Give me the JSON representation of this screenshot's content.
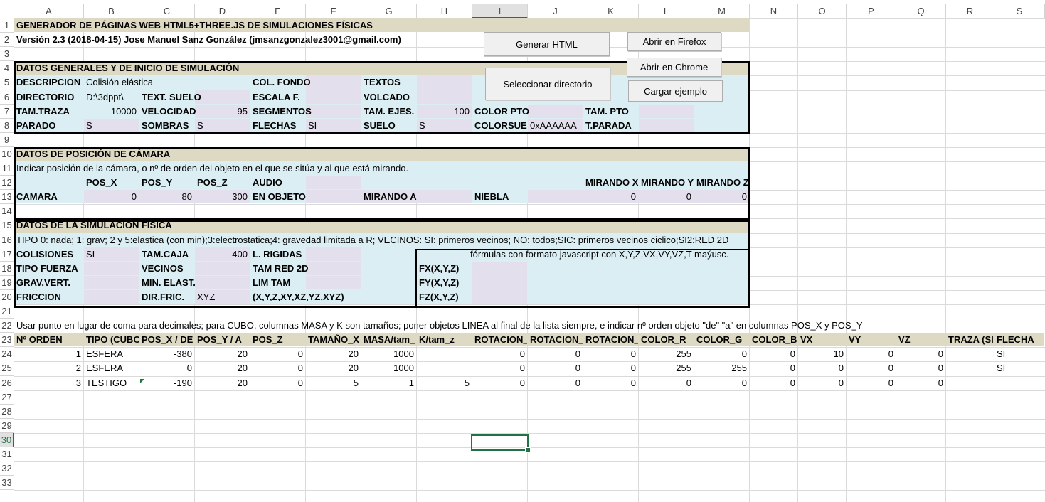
{
  "columns": [
    "A",
    "B",
    "C",
    "D",
    "E",
    "F",
    "G",
    "H",
    "I",
    "J",
    "K",
    "L",
    "M",
    "N",
    "O",
    "P",
    "Q",
    "R",
    "S"
  ],
  "rows": [
    "1",
    "2",
    "3",
    "4",
    "5",
    "6",
    "7",
    "8",
    "9",
    "10",
    "11",
    "12",
    "13",
    "14",
    "15",
    "16",
    "17",
    "18",
    "19",
    "20",
    "21",
    "22",
    "23",
    "24",
    "25",
    "26",
    "27",
    "28",
    "29",
    "30",
    "31",
    "32",
    "33"
  ],
  "selected": {
    "column": "I",
    "row": "30"
  },
  "colors": {
    "header_band": "#ddd9c3",
    "panel": "#daeef3",
    "input": "#e4dfec",
    "accent": "#217346"
  },
  "buttons": {
    "generate": "Generar HTML",
    "firefox": "Abrir en Firefox",
    "select_dir": "Seleccionar directorio",
    "chrome": "Abrir en Chrome",
    "example": "Cargar ejemplo"
  },
  "title": "GENERADOR DE PÁGINAS WEB HTML5+THREE.JS DE SIMULACIONES FÍSICAS",
  "version": "Versión 2.3 (2018-04-15) Jose Manuel Sanz González (jmsanzgonzalez3001@gmail.com)",
  "general": {
    "heading": "DATOS GENERALES Y DE INICIO DE SIMULACIÓN",
    "descripcion_label": "DESCRIPCION",
    "descripcion_value": "Colisión elástica",
    "col_fondo": "COL. FONDO",
    "textos": "TEXTOS",
    "directorio_label": "DIRECTORIO",
    "directorio_value": "D:\\3dppt\\",
    "text_suelo": "TEXT. SUELO",
    "escala": "ESCALA F.",
    "volcado": "VOLCADO",
    "tam_traza_label": "TAM.TRAZA",
    "tam_traza_value": "10000",
    "velocidad_label": "VELOCIDAD",
    "velocidad_value": "95",
    "segmentos": "SEGMENTOS",
    "tam_ejes_label": "TAM. EJES.",
    "tam_ejes_value": "100",
    "color_pto": "COLOR PTO",
    "tam_pto": "TAM. PTO",
    "parado_label": "PARADO",
    "parado_value": "S",
    "sombras_label": "SOMBRAS",
    "sombras_value": "S",
    "flechas_label": "FLECHAS",
    "flechas_value": "SI",
    "suelo_label": "SUELO",
    "suelo_value": "S",
    "colorsuelo_label": "COLORSUELO",
    "colorsuelo_value": "0xAAAAAA",
    "t_parada": "T.PARADA"
  },
  "camera": {
    "heading": "DATOS DE POSICIÓN DE CÁMARA",
    "hint": "Indicar posición de la cámara, o nº de orden del objeto en el que se sitúa y al que está mirando.",
    "pos_x": "POS_X",
    "pos_y": "POS_Y",
    "pos_z": "POS_Z",
    "audio": "AUDIO",
    "mirando_x": "MIRANDO X",
    "mirando_y": "MIRANDO Y",
    "mirando_z": "MIRANDO Z",
    "camara": "CAMARA",
    "x_value": "0",
    "y_value": "80",
    "z_value": "300",
    "en_objeto": "EN OBJETO",
    "mirando_a": "MIRANDO A",
    "niebla": "NIEBLA",
    "mx": "0",
    "my": "0",
    "mz": "0"
  },
  "physics": {
    "heading": "DATOS DE LA SIMULACIÓN FÍSICA",
    "hint": "TIPO 0: nada; 1: grav; 2 y 5:elastica (con min);3:electrostatica;4: gravedad limitada a R; VECINOS: SI: primeros vecinos; NO: todos;SIC: primeros vecinos ciclico;SI2:RED 2D",
    "colisiones_label": "COLISIONES",
    "colisiones_value": "SI",
    "tam_caja_label": "TAM.CAJA",
    "tam_caja_value": "400",
    "l_rigidas": "L. RIGIDAS",
    "formulas": "fórmulas con formato javascript con X,Y,Z,VX,VY,VZ,T maýusc.",
    "tipo_fuerza": "TIPO FUERZA",
    "vecinos": "VECINOS",
    "tam_red": "TAM RED 2D",
    "fx": "FX(X,Y,Z)",
    "grav_vert": "GRAV.VERT.",
    "min_elast": "MIN. ELAST.",
    "lim_tam": "LIM TAM",
    "fy": "FY(X,Y,Z)",
    "friccion": "FRICCION",
    "dir_fric_label": "DIR.FRIC.",
    "dir_fric_value": "XYZ",
    "combos": "(X,Y,Z,XY,XZ,YZ,XYZ)",
    "fz": "FZ(X,Y,Z)"
  },
  "note": "Usar punto en lugar de coma para decimales; para CUBO, columnas MASA y K son tamaños; poner objetos LINEA al final de la lista siempre, e indicar nº orden objeto \"de\" \"a\" en columnas POS_X y POS_Y",
  "objects": {
    "headers": [
      "Nº ORDEN",
      "TIPO (CUBO,",
      "POS_X / DE",
      "POS_Y / A",
      "POS_Z",
      "TAMAÑO_X",
      "MASA/tam_",
      "K/tam_z",
      "ROTACION_X",
      "ROTACION_Y",
      "ROTACION_Z",
      "COLOR_R",
      "COLOR_G",
      "COLOR_B",
      "VX",
      "VY",
      "VZ",
      "TRAZA (SI/NO)",
      "FLECHA"
    ],
    "rows": [
      [
        "1",
        "ESFERA",
        "-380",
        "20",
        "0",
        "20",
        "1000",
        "",
        "0",
        "0",
        "0",
        "255",
        "0",
        "0",
        "10",
        "0",
        "0",
        "",
        "SI"
      ],
      [
        "2",
        "ESFERA",
        "0",
        "20",
        "0",
        "20",
        "1000",
        "",
        "0",
        "0",
        "0",
        "255",
        "255",
        "0",
        "0",
        "0",
        "0",
        "",
        "SI"
      ],
      [
        "3",
        "TESTIGO",
        "-190",
        "20",
        "0",
        "5",
        "1",
        "5",
        "0",
        "0",
        "0",
        "0",
        "0",
        "0",
        "0",
        "0",
        "0",
        "",
        ""
      ]
    ]
  }
}
